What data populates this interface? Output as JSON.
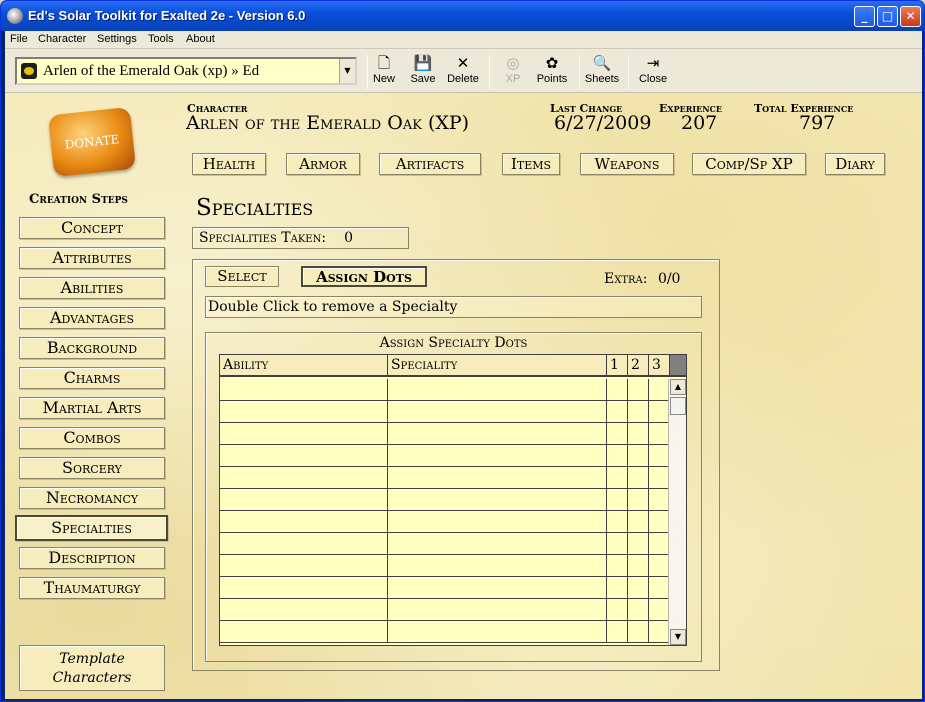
{
  "window": {
    "title": "Ed's Solar Toolkit for Exalted 2e - Version 6.0"
  },
  "menu": [
    "File",
    "Character",
    "Settings",
    "Tools",
    "About"
  ],
  "toolbar": {
    "character_select": "Arlen of the Emerald Oak (xp) » Ed",
    "new": "New",
    "save": "Save",
    "delete": "Delete",
    "xp": "XP",
    "points": "Points",
    "sheets": "Sheets",
    "close": "Close"
  },
  "donate": "DONATE",
  "header": {
    "character_label": "Character",
    "character_value": "Arlen of the Emerald Oak (XP)",
    "last_change_label": "Last Change",
    "last_change_value": "6/27/2009",
    "experience_label": "Experience",
    "experience_value": "207",
    "total_experience_label": "Total Experience",
    "total_experience_value": "797"
  },
  "tabs": [
    "Health",
    "Armor",
    "Artifacts",
    "Items",
    "Weapons",
    "Comp/Sp XP",
    "Diary"
  ],
  "creation_steps": {
    "title": "Creation Steps",
    "items": [
      "Concept",
      "Attributes",
      "Abilities",
      "Advantages",
      "Background",
      "Charms",
      "Martial Arts",
      "Combos",
      "Sorcery",
      "Necromancy",
      "Specialties",
      "Description",
      "Thaumaturgy"
    ],
    "active": "Specialties",
    "template_line1": "Template",
    "template_line2": "Characters"
  },
  "main": {
    "section_title": "Specialties",
    "taken_label": "Specialities Taken:",
    "taken_value": "0",
    "subtabs": [
      "Select",
      "Assign Dots"
    ],
    "active_subtab": "Assign Dots",
    "extra_label": "Extra:",
    "extra_value": "0/0",
    "hint": "Double Click to remove a Specialty",
    "assign_title": "Assign Specialty Dots",
    "columns": [
      "Ability",
      "Speciality",
      "1",
      "2",
      "3"
    ]
  }
}
